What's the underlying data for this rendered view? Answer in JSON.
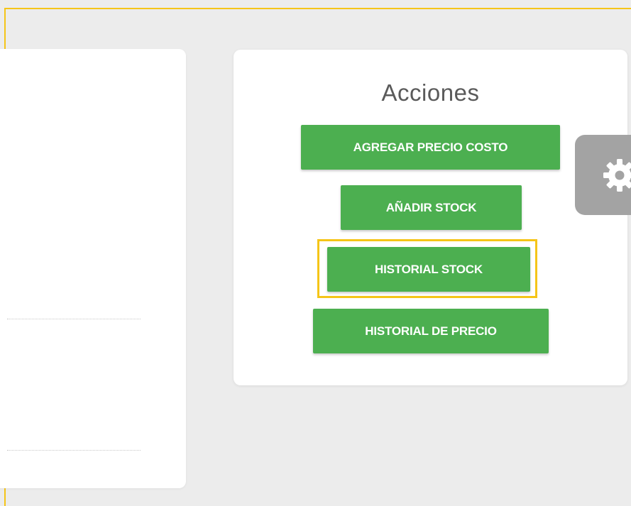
{
  "actions_panel": {
    "title": "Acciones",
    "buttons": [
      {
        "label": "AGREGAR PRECIO COSTO"
      },
      {
        "label": "AÑADIR STOCK"
      },
      {
        "label": "HISTORIAL STOCK",
        "highlighted": true
      },
      {
        "label": "HISTORIAL DE PRECIO"
      }
    ]
  },
  "settings_tab": {
    "icon": "gear-icon"
  },
  "colors": {
    "button_green": "#4caf50",
    "highlight_yellow": "#f5c518",
    "background": "#ececec",
    "settings_tab_gray": "#a3a3a3"
  }
}
